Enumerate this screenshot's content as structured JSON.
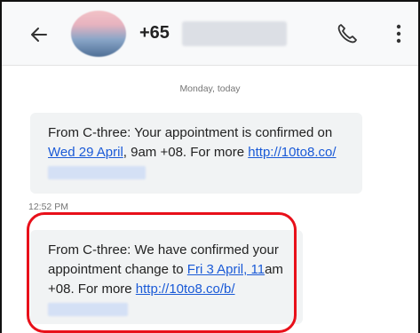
{
  "header": {
    "contact_number": "+65",
    "icons": [
      "back-arrow-icon",
      "avatar",
      "phone-icon",
      "more-vert-icon"
    ]
  },
  "conversation": {
    "date_separator": "Monday, today",
    "message1": {
      "text_a": "From C-three: Your appointment is confirmed on ",
      "date_link": "Wed 29 April",
      "text_b": ", 9am +08. For more ",
      "url_link": "http://10to8.co/"
    },
    "timestamp": "12:52 PM",
    "message2": {
      "text_a": "From C-three: We have confirmed your appointment change to ",
      "date_link": "Fri 3 April, 11",
      "text_b": "am +08. For more ",
      "url_link": "http://10to8.co/b/"
    }
  },
  "colors": {
    "bubble_bg": "#f1f3f4",
    "link": "#1a5ad7",
    "highlight": "#e8101a"
  }
}
